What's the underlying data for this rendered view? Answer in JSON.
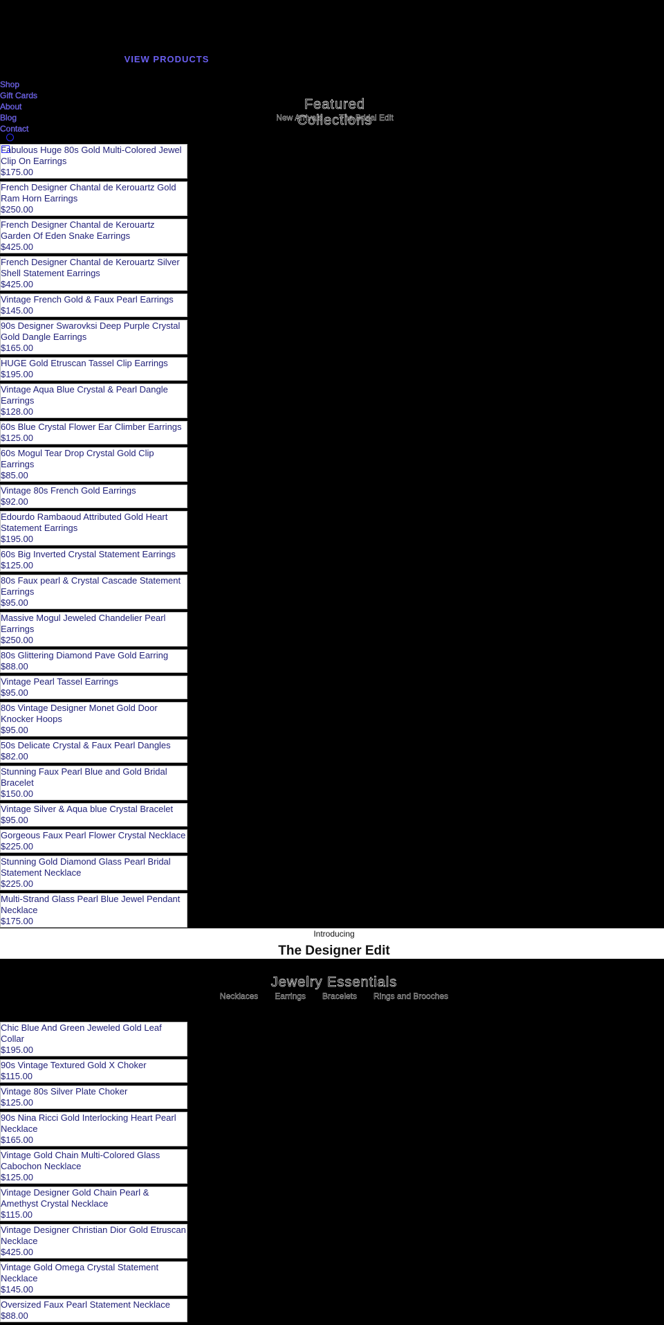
{
  "header": {
    "view_products": "VIEW PRODUCTS"
  },
  "nav": {
    "items": [
      {
        "label": "Shop"
      },
      {
        "label": "Gift Cards"
      },
      {
        "label": "About"
      },
      {
        "label": "Blog"
      },
      {
        "label": "Contact"
      }
    ]
  },
  "icons": {
    "search": "search-icon",
    "cart": "cart-icon"
  },
  "featured": {
    "title": "Featured Collections",
    "links": [
      {
        "label": "New Arrivals"
      },
      {
        "label": "The Bridal Edit"
      }
    ]
  },
  "products1": [
    {
      "name": "Fabulous Huge 80s Gold Multi-Colored Jewel Clip On Earrings",
      "price": "$175.00"
    },
    {
      "name": "French Designer Chantal de Kerouartz Gold Ram Horn Earrings",
      "price": "$250.00"
    },
    {
      "name": "French Designer Chantal de Kerouartz Garden Of Eden Snake Earrings",
      "price": "$425.00"
    },
    {
      "name": "French Designer Chantal de Kerouartz Silver Shell Statement Earrings",
      "price": "$425.00"
    },
    {
      "name": "Vintage French Gold & Faux Pearl Earrings",
      "price": "$145.00"
    },
    {
      "name": "90s Designer Swarovksi Deep Purple Crystal Gold Dangle Earrings",
      "price": "$165.00"
    },
    {
      "name": "HUGE Gold Etruscan Tassel Clip Earrings",
      "price": "$195.00"
    },
    {
      "name": "Vintage Aqua Blue Crystal & Pearl Dangle Earrings",
      "price": "$128.00"
    },
    {
      "name": "60s Blue Crystal Flower Ear Climber Earrings",
      "price": "$125.00"
    },
    {
      "name": "60s Mogul Tear Drop Crystal Gold Clip Earrings",
      "price": "$85.00"
    },
    {
      "name": "Vintage 80s French Gold Earrings",
      "price": "$92.00"
    },
    {
      "name": "Edourdo Rambaoud Attributed Gold Heart Statement Earrings",
      "price": "$195.00"
    },
    {
      "name": "60s Big Inverted Crystal Statement Earrings",
      "price": "$125.00"
    },
    {
      "name": "80s Faux pearl & Crystal Cascade Statement Earrings",
      "price": "$95.00"
    },
    {
      "name": "Massive Mogul Jeweled Chandelier Pearl Earrings",
      "price": "$250.00"
    },
    {
      "name": "80s Glittering Diamond Pave Gold Earring",
      "price": "$88.00"
    },
    {
      "name": "Vintage Pearl Tassel Earrings",
      "price": "$95.00"
    },
    {
      "name": "80s Vintage Designer Monet Gold Door Knocker Hoops",
      "price": "$95.00"
    },
    {
      "name": "50s Delicate Crystal & Faux Pearl Dangles",
      "price": "$82.00"
    },
    {
      "name": "Stunning Faux Pearl Blue and Gold Bridal Bracelet",
      "price": "$150.00"
    },
    {
      "name": "Vintage Silver & Aqua blue Crystal Bracelet",
      "price": "$95.00"
    },
    {
      "name": "Gorgeous Faux Pearl Flower Crystal Necklace",
      "price": "$225.00"
    },
    {
      "name": "Stunning Gold Diamond Glass Pearl Bridal Statement Necklace",
      "price": "$225.00"
    },
    {
      "name": "Multi-Strand Glass Pearl Blue Jewel Pendant Necklace",
      "price": "$175.00"
    }
  ],
  "designer_edit": {
    "intro": "Introducing",
    "title": "The Designer Edit"
  },
  "essentials": {
    "title": "Jewelry Essentials",
    "links": [
      {
        "label": "Necklaces"
      },
      {
        "label": "Earrings"
      },
      {
        "label": "Bracelets"
      },
      {
        "label": "Rings and Brooches"
      }
    ]
  },
  "products2": [
    {
      "name": "Chic Blue And Green Jeweled Gold Leaf Collar",
      "price": "$195.00"
    },
    {
      "name": "90s Vintage Textured Gold X Choker",
      "price": "$115.00"
    },
    {
      "name": "Vintage 80s Silver Plate Choker",
      "price": "$125.00"
    },
    {
      "name": "90s Nina Ricci Gold Interlocking Heart Pearl Necklace",
      "price": "$165.00"
    },
    {
      "name": "Vintage Gold Chain Multi-Colored Glass Cabochon Necklace",
      "price": "$125.00"
    },
    {
      "name": "Vintage Designer Gold Chain Pearl & Amethyst Crystal Necklace",
      "price": "$115.00"
    },
    {
      "name": "Vintage Designer Christian Dior Gold Etruscan Necklace",
      "price": "$425.00"
    },
    {
      "name": "Vintage Gold Omega Crystal Statement Necklace",
      "price": "$145.00"
    },
    {
      "name": "Oversized Faux Pearl Statement Necklace",
      "price": "$88.00"
    }
  ],
  "colors": {
    "link": "#5b4fe0",
    "product_text": "#22227a",
    "background": "#000000",
    "card": "#ffffff"
  }
}
